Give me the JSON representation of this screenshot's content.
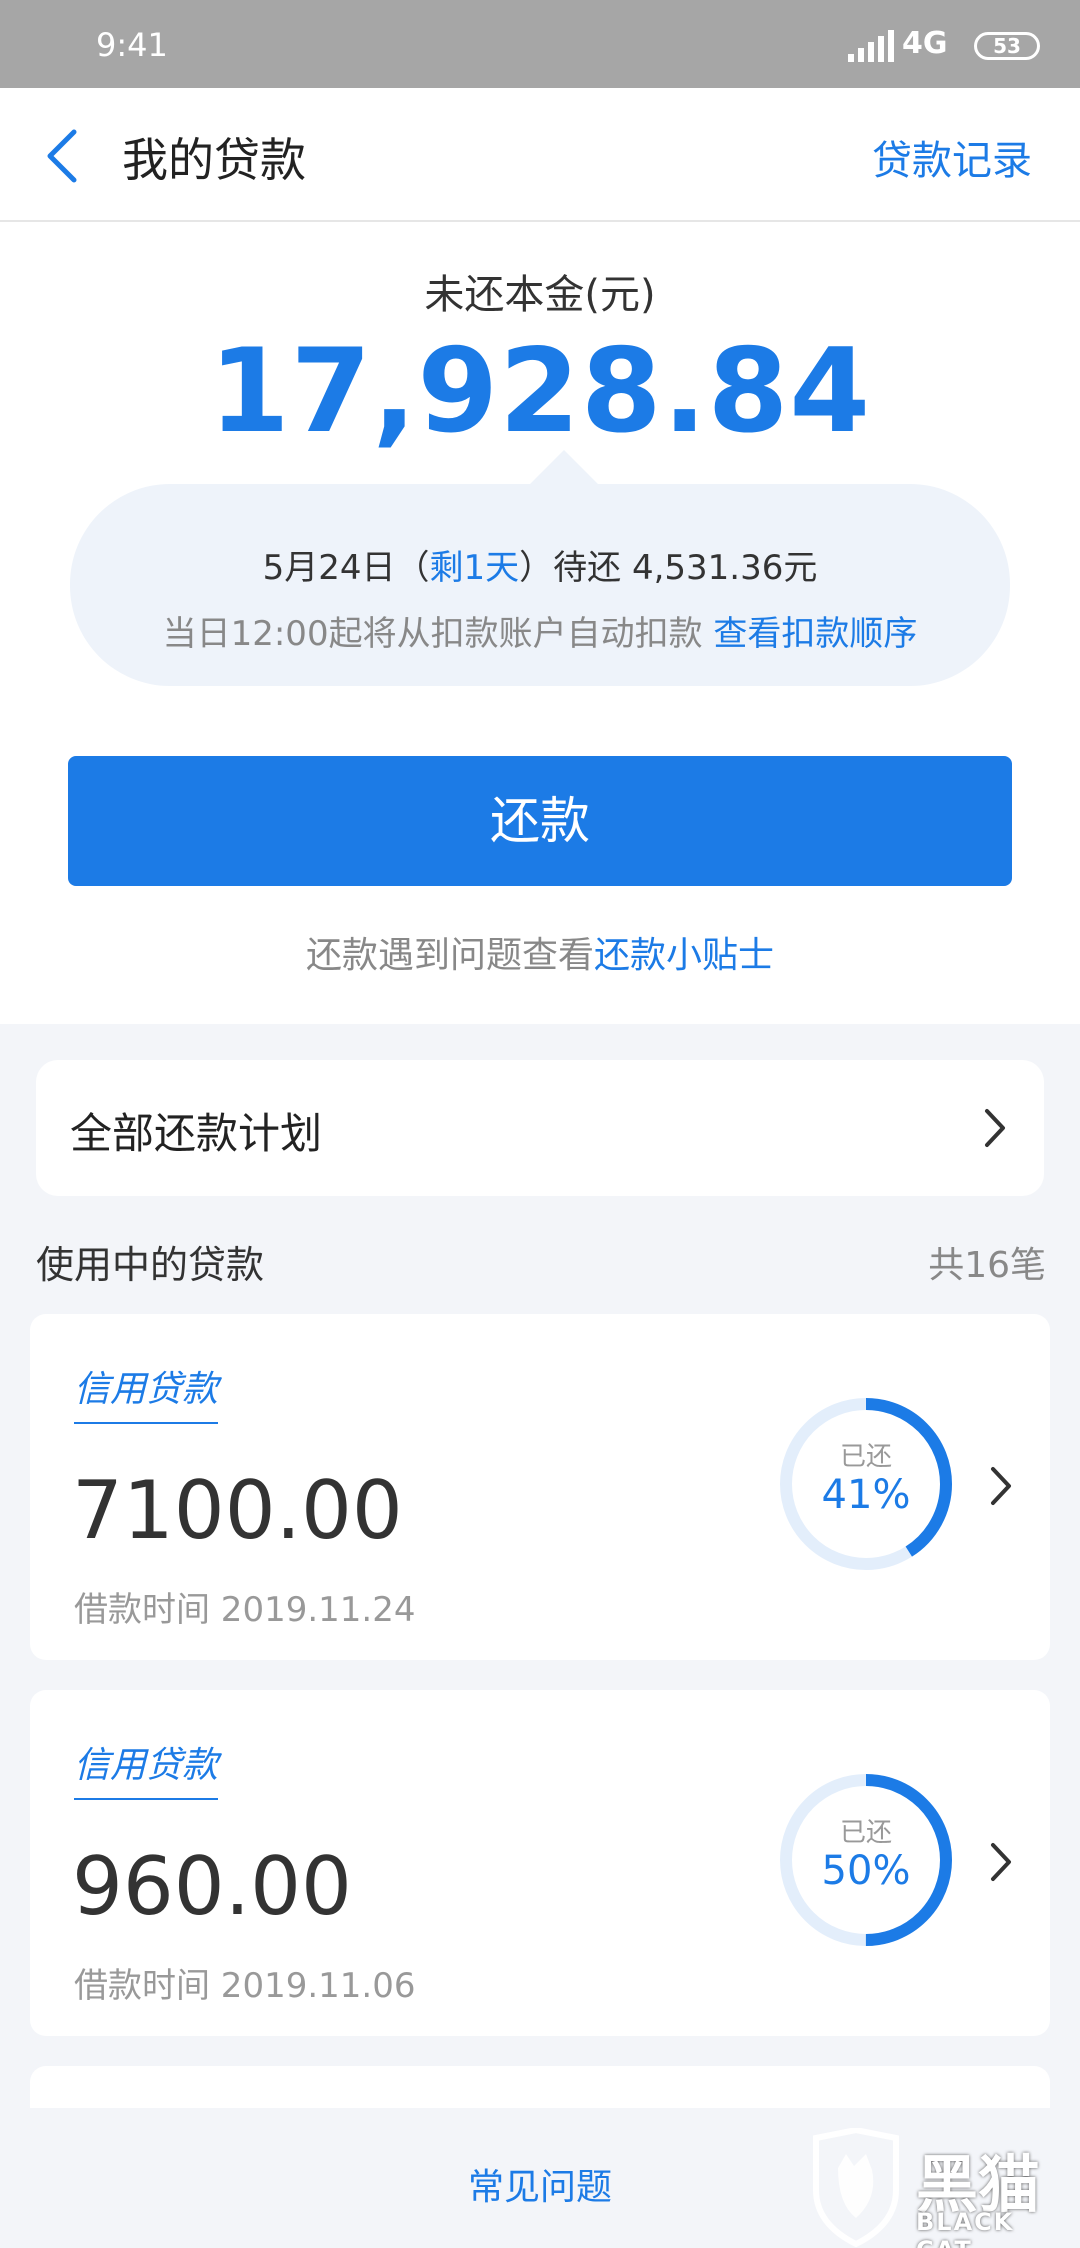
{
  "status_bar": {
    "time": "9:41",
    "network": "4G",
    "battery": "53"
  },
  "nav": {
    "title": "我的贷款",
    "record_link": "贷款记录"
  },
  "summary": {
    "label": "未还本金(元)",
    "amount": "17,928.84",
    "due_date": "5月24日（",
    "remaining": "剩1天",
    "due_suffix": "）待还 4,531.36元",
    "auto_debit_text": "当日12:00起将从扣款账户自动扣款 ",
    "auto_debit_link": "查看扣款顺序",
    "repay_button": "还款",
    "tips_text": "还款遇到问题查看",
    "tips_link": "还款小贴士"
  },
  "plan": {
    "label": "全部还款计划"
  },
  "loans_section": {
    "title": "使用中的贷款",
    "count": "共16笔"
  },
  "loans": [
    {
      "type": "信用贷款",
      "amount": "7100.00",
      "date": "借款时间 2019.11.24",
      "repaid_label": "已还",
      "repaid_text": "41%",
      "repaid_fraction": 0.41
    },
    {
      "type": "信用贷款",
      "amount": "960.00",
      "date": "借款时间 2019.11.06",
      "repaid_label": "已还",
      "repaid_text": "50%",
      "repaid_fraction": 0.5
    }
  ],
  "footer": {
    "faq": "常见问题"
  },
  "watermark": {
    "cn": "黑猫",
    "en": "BLACK CAT"
  },
  "colors": {
    "accent": "#1c7be6",
    "ring_track": "#e3eefb",
    "background": "#f3f5f9"
  }
}
